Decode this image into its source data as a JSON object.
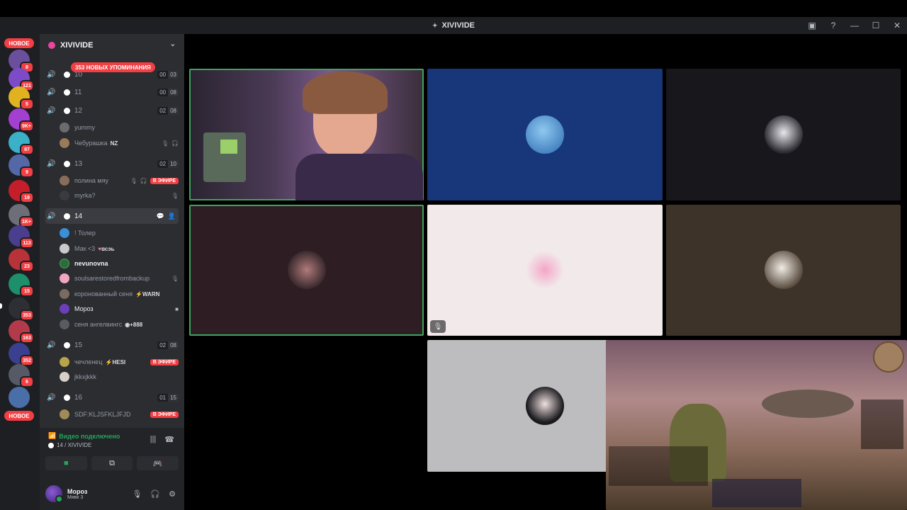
{
  "window": {
    "title": "XIVIVIDE"
  },
  "rail": {
    "new_label_top": "НОВОЕ",
    "new_label_bottom": "НОВОЕ",
    "servers": [
      {
        "badge": "8",
        "color": "#6b4f9c"
      },
      {
        "badge": "121",
        "color": "#7d4bc8"
      },
      {
        "badge": "5",
        "color": "#e0b21f"
      },
      {
        "badge": "9K+",
        "color": "#a33fd1"
      },
      {
        "badge": "87",
        "color": "#3bb0c9"
      },
      {
        "badge": "9",
        "color": "#5468a8"
      },
      {
        "badge": "19",
        "color": "#c41e2a"
      },
      {
        "badge": "1K+",
        "color": "#6e6e78"
      },
      {
        "badge": "113",
        "color": "#4a3e8e"
      },
      {
        "badge": "23",
        "color": "#b8323a"
      },
      {
        "badge": "15",
        "color": "#1d8f6a"
      },
      {
        "badge": "353",
        "color": "#2d2f35"
      },
      {
        "badge": "163",
        "color": "#b33a4a"
      },
      {
        "badge": "352",
        "color": "#3a3f8f"
      },
      {
        "badge": "6",
        "color": "#555a66"
      },
      {
        "badge": "",
        "color": "#4a6ea8"
      }
    ]
  },
  "sidebar": {
    "server_name": "XIVIVIDE",
    "mentions": "353 НОВЫХ УПОМИНАНИЯ",
    "channels": [
      {
        "name": "10",
        "count_a": "00",
        "count_b": "03"
      },
      {
        "name": "11",
        "count_a": "00",
        "count_b": "08"
      },
      {
        "name": "12",
        "count_a": "02",
        "count_b": "08"
      },
      {
        "name": "13",
        "count_a": "02",
        "count_b": "10"
      },
      {
        "name": "14"
      },
      {
        "name": "15",
        "count_a": "02",
        "count_b": "08"
      },
      {
        "name": "16",
        "count_a": "01",
        "count_b": "15"
      }
    ],
    "members": {
      "yummy": "yummy",
      "cheburashka": "Чебурашка",
      "cheburashka_tag": "NZ",
      "polina": "полина мяу",
      "myrka": "myrka?",
      "toler": "! Толер",
      "mak": "Мак <3",
      "mak_tag": "всэь",
      "nevunovna": "nevunovna",
      "souls": "soulsarestoredfrombackup",
      "koron": "коронованный сеня",
      "koron_tag": "WARN",
      "moroz": "Мороз",
      "senya": "сеня ангелвингс",
      "senya_tag": "+888",
      "chelenec": "чечленец",
      "chelenec_tag": "HESI",
      "jkkxjkk": "jkkxjkkk",
      "sdf": "SDF:KLJSFKLJFJD"
    },
    "live_label": "В ЭФИРЕ"
  },
  "voice_panel": {
    "status": "Видео подключено",
    "channel": "14 / XIVIVIDE"
  },
  "user": {
    "name": "Мороз",
    "status": "Мявк 3"
  },
  "icons": {
    "speaker": "speaker-icon",
    "mic": "mic-icon",
    "headphones": "headphones-icon",
    "settings": "gear-icon"
  }
}
